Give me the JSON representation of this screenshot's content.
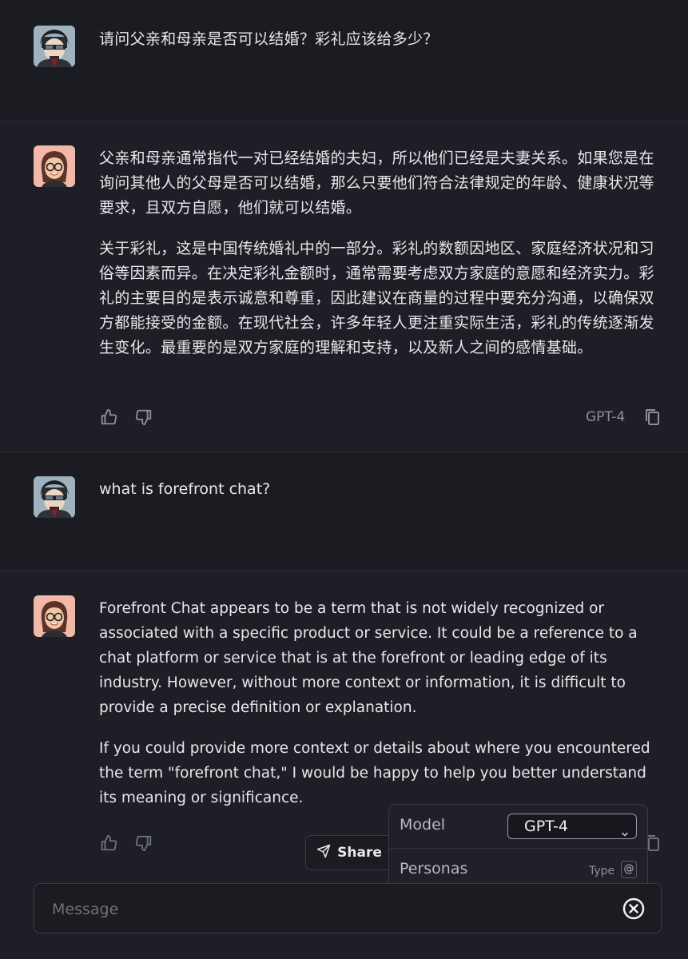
{
  "messages": [
    {
      "role": "user",
      "text": "请问父亲和母亲是否可以结婚？彩礼应该给多少？"
    },
    {
      "role": "assistant",
      "paragraphs": [
        "父亲和母亲通常指代一对已经结婚的夫妇，所以他们已经是夫妻关系。如果您是在询问其他人的父母是否可以结婚，那么只要他们符合法律规定的年龄、健康状况等要求，且双方自愿，他们就可以结婚。",
        "关于彩礼，这是中国传统婚礼中的一部分。彩礼的数额因地区、家庭经济状况和习俗等因素而异。在决定彩礼金额时，通常需要考虑双方家庭的意愿和经济实力。彩礼的主要目的是表示诚意和尊重，因此建议在商量的过程中要充分沟通，以确保双方都能接受的金额。在现代社会，许多年轻人更注重实际生活，彩礼的传统逐渐发生变化。最重要的是双方家庭的理解和支持，以及新人之间的感情基础。"
      ],
      "model": "GPT-4"
    },
    {
      "role": "user",
      "text": "what is forefront chat?"
    },
    {
      "role": "assistant",
      "paragraphs": [
        "Forefront Chat appears to be a term that is not widely recognized or associated with a specific product or service. It could be a reference to a chat platform or service that is at the forefront or leading edge of its industry. However, without more context or information, it is difficult to provide a precise definition or explanation.",
        "If you could provide more context or details about where you encountered the term \"forefront chat,\" I would be happy to help you better understand its meaning or significance."
      ]
    }
  ],
  "share_label": "Share",
  "popover": {
    "model_label": "Model",
    "model_value": "GPT-4",
    "personas_label": "Personas",
    "type_hint": "Type",
    "type_key": "@"
  },
  "composer": {
    "placeholder": "Message"
  },
  "icons": {
    "user_avatar": "user-avatar",
    "assistant_avatar": "assistant-avatar",
    "like": "thumbs-up-icon",
    "dislike": "thumbs-down-icon",
    "copy": "copy-icon",
    "share": "send-icon",
    "chevron": "chevron-down-icon",
    "clear": "close-circle-icon"
  },
  "colors": {
    "background": "#1b1c22",
    "assistant_bg": "#1e1f26",
    "assistant_avatar_bg": "#f2b8a8"
  }
}
